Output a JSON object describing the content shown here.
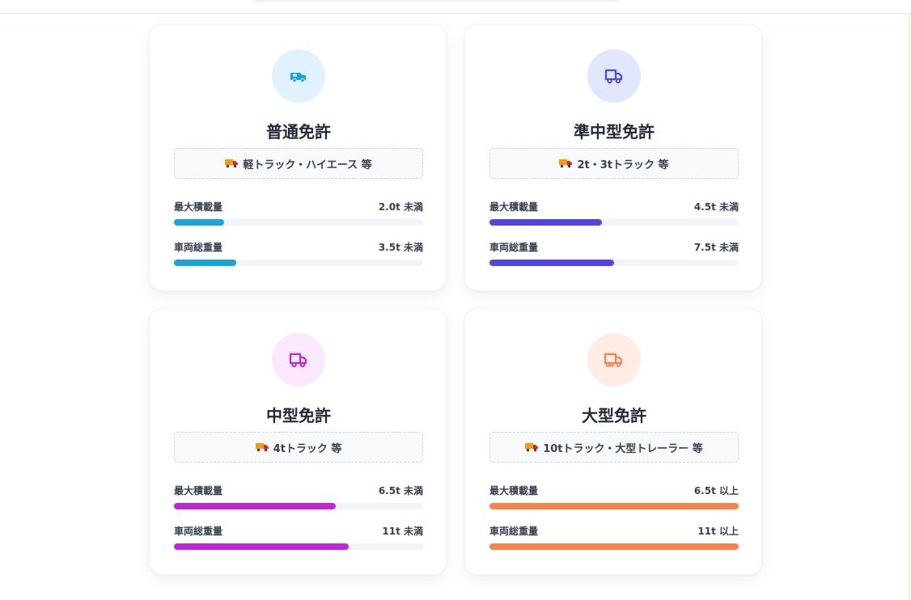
{
  "cards": [
    {
      "title": "普通免許",
      "vehicles": "軽トラック・ハイエース 等",
      "icon": "van-icon",
      "accent": "#1aa4dc",
      "icon_bg": "#e0f2fe",
      "specs": [
        {
          "label": "最大積載量",
          "value": "2.0t 未満",
          "fill": 0.2
        },
        {
          "label": "車両総重量",
          "value": "3.5t 未満",
          "fill": 0.25
        }
      ]
    },
    {
      "title": "準中型免許",
      "vehicles": "2t・3tトラック 等",
      "icon": "truck-icon",
      "accent": "#4f46e5",
      "icon_bg": "#e0e7ff",
      "specs": [
        {
          "label": "最大積載量",
          "value": "4.5t 未満",
          "fill": 0.45
        },
        {
          "label": "車両総重量",
          "value": "7.5t 未満",
          "fill": 0.5
        }
      ]
    },
    {
      "title": "中型免許",
      "vehicles": "4tトラック 等",
      "icon": "truck-icon",
      "accent": "#c026d3",
      "icon_bg": "#fae8ff",
      "specs": [
        {
          "label": "最大積載量",
          "value": "6.5t 未満",
          "fill": 0.65
        },
        {
          "label": "車両総重量",
          "value": "11t 未満",
          "fill": 0.7
        }
      ]
    },
    {
      "title": "大型免許",
      "vehicles": "10tトラック・大型トレーラー 等",
      "icon": "truck-icon",
      "accent": "#f9824a",
      "icon_bg": "#ffede5",
      "specs": [
        {
          "label": "最大積載量",
          "value": "6.5t 以上",
          "fill": 1.0
        },
        {
          "label": "車両総重量",
          "value": "11t 以上",
          "fill": 1.0
        }
      ]
    }
  ]
}
